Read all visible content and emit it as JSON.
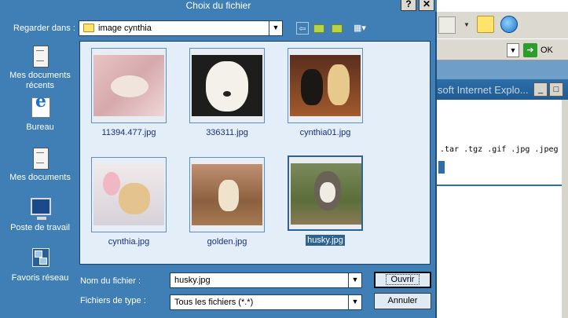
{
  "background_window": {
    "title_fragment": "soft Internet Explo...",
    "address_go_label": "OK",
    "extensions_text": ".tar .tgz .gif .jpg .jpeg .png)"
  },
  "dialog": {
    "title": "Choix du fichier",
    "help_button": "?",
    "close_button": "✕",
    "look_in": {
      "label": "Regarder dans :",
      "value": "image cynthia",
      "dropdown": "▼"
    },
    "places": [
      {
        "label": "Mes documents récents",
        "icon": "recent-documents-icon"
      },
      {
        "label": "Bureau",
        "icon": "desktop-icon"
      },
      {
        "label": "Mes documents",
        "icon": "my-documents-icon"
      },
      {
        "label": "Poste de travail",
        "icon": "my-computer-icon"
      },
      {
        "label": "Favoris réseau",
        "icon": "network-places-icon"
      }
    ],
    "files": [
      {
        "name": "11394.477.jpg",
        "selected": false
      },
      {
        "name": "336311.jpg",
        "selected": false
      },
      {
        "name": "cynthia01.jpg",
        "selected": false
      },
      {
        "name": "cynthia.jpg",
        "selected": false
      },
      {
        "name": "golden.jpg",
        "selected": false
      },
      {
        "name": "husky.jpg",
        "selected": true
      }
    ],
    "file_name": {
      "label": "Nom du fichier :",
      "value": "husky.jpg"
    },
    "file_type": {
      "label": "Fichiers de type :",
      "value": "Tous les fichiers (*.*)"
    },
    "open_button": "Ouvrir",
    "cancel_button": "Annuler"
  },
  "colors": {
    "dialog_bg": "#3f7fb5",
    "file_area_bg": "#e3eef9",
    "selection": "#2d6291"
  }
}
